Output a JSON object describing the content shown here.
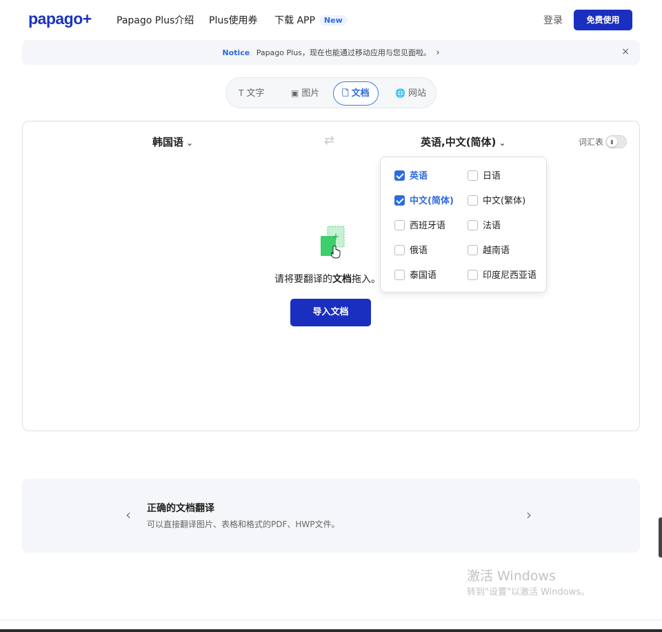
{
  "header": {
    "logo": "papago",
    "logo_plus": "+",
    "nav": [
      "Papago Plus介绍",
      "Plus使用券",
      "下载 APP"
    ],
    "new_badge": "New",
    "login": "登录",
    "cta": "免费使用"
  },
  "notice": {
    "tag": "Notice",
    "text": "Papago Plus，现在也能通过移动应用与您见面啦。",
    "arrow": "›",
    "close": "×"
  },
  "tabs": [
    {
      "icon": "T",
      "label": "文字",
      "active": false
    },
    {
      "icon": "▣",
      "label": "图片",
      "active": false
    },
    {
      "icon": "🗋",
      "label": "文档",
      "active": true
    },
    {
      "icon": "🌐",
      "label": "网站",
      "active": false
    }
  ],
  "translator": {
    "source_lang": "韩国语",
    "swap_icon": "⇄",
    "target_lang": "英语,中文(简体)",
    "glossary_label": "词汇表",
    "drop_text_before": "请将要翻译的",
    "drop_text_bold": "文档",
    "drop_text_after": "拖入。",
    "import_button": "导入文档"
  },
  "language_menu": [
    {
      "label": "英语",
      "checked": true
    },
    {
      "label": "日语",
      "checked": false
    },
    {
      "label": "中文(简体)",
      "checked": true
    },
    {
      "label": "中文(繁体)",
      "checked": false
    },
    {
      "label": "西班牙语",
      "checked": false
    },
    {
      "label": "法语",
      "checked": false
    },
    {
      "label": "俄语",
      "checked": false
    },
    {
      "label": "越南语",
      "checked": false
    },
    {
      "label": "泰国语",
      "checked": false
    },
    {
      "label": "印度尼西亚语",
      "checked": false
    }
  ],
  "feature": {
    "title": "正确的文档翻译",
    "desc": "可以直接翻译图片、表格和格式的PDF、HWP文件。",
    "prev": "‹",
    "next": "›"
  },
  "watermark": {
    "title": "激活 Windows",
    "sub": "转到\"设置\"以激活 Windows。"
  },
  "colors": {
    "brand": "#1a2fbf",
    "accent": "#2d6be0",
    "doc_icon": "#3ccf6b"
  }
}
